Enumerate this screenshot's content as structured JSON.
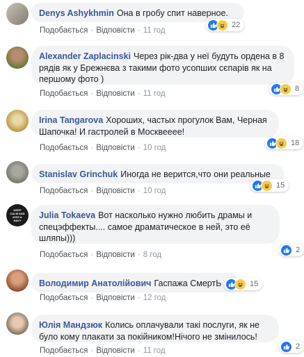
{
  "ui": {
    "like_label": "Подобається",
    "reply_label": "Відповісти",
    "separator": "·"
  },
  "colors": {
    "author": "#385898",
    "bubble": "#f2f3f5",
    "like": "#2078f4",
    "haha": "#f7cc43"
  },
  "comments": [
    {
      "author": "Denys Ashykhmin",
      "text": "Она в гробу спит наверное.",
      "time": "11 год",
      "reactions": [
        "like-icon",
        "haha-icon"
      ],
      "count": "22"
    },
    {
      "author": "Alexander Zaplacinski",
      "text": "Через рік-два у неї будуть ордена в 8 рядів як у Брежнєва з такими фото усопших сєпарів як на першому фото )",
      "time": "11 год",
      "reactions": [
        "like-icon",
        "haha-icon"
      ],
      "count": "8"
    },
    {
      "author": "Irina Tangarova",
      "text": "Хороших, частых прогулок Вам, Черная Шапочка! И гастролей в Москвееее!",
      "time": "10 год",
      "reactions": [
        "like-icon",
        "haha-icon"
      ],
      "count": "18"
    },
    {
      "author": "Stanislav Grinchuk",
      "text": "Иногда не верится,что они реальные",
      "time": "10 год",
      "reactions": [
        "like-icon",
        "haha-icon"
      ],
      "count": "15"
    },
    {
      "author": "Julia Tokaeva",
      "text": "Вот насколько нужно любить драмы и спецэффекты.... самое драматическое в ней, это её шляпы)))",
      "time": "8 год",
      "reactions": [
        "like-icon"
      ],
      "count": "2",
      "avatar_text": "KEEP CALM AND KISS A NAVY"
    },
    {
      "author": "Володимир Анатолійович",
      "text": "Гаспажа СмертЬ",
      "time": "12 год",
      "reactions": [
        "like-icon",
        "haha-icon"
      ],
      "count": "15"
    },
    {
      "author": "Юлія Мандзюк",
      "text": "Колись оплачували такі послуги, як не було кому плакати за покійником!Нічого не змінилось!",
      "time": "11 год",
      "reactions": [
        "like-icon"
      ],
      "count": "2"
    }
  ]
}
